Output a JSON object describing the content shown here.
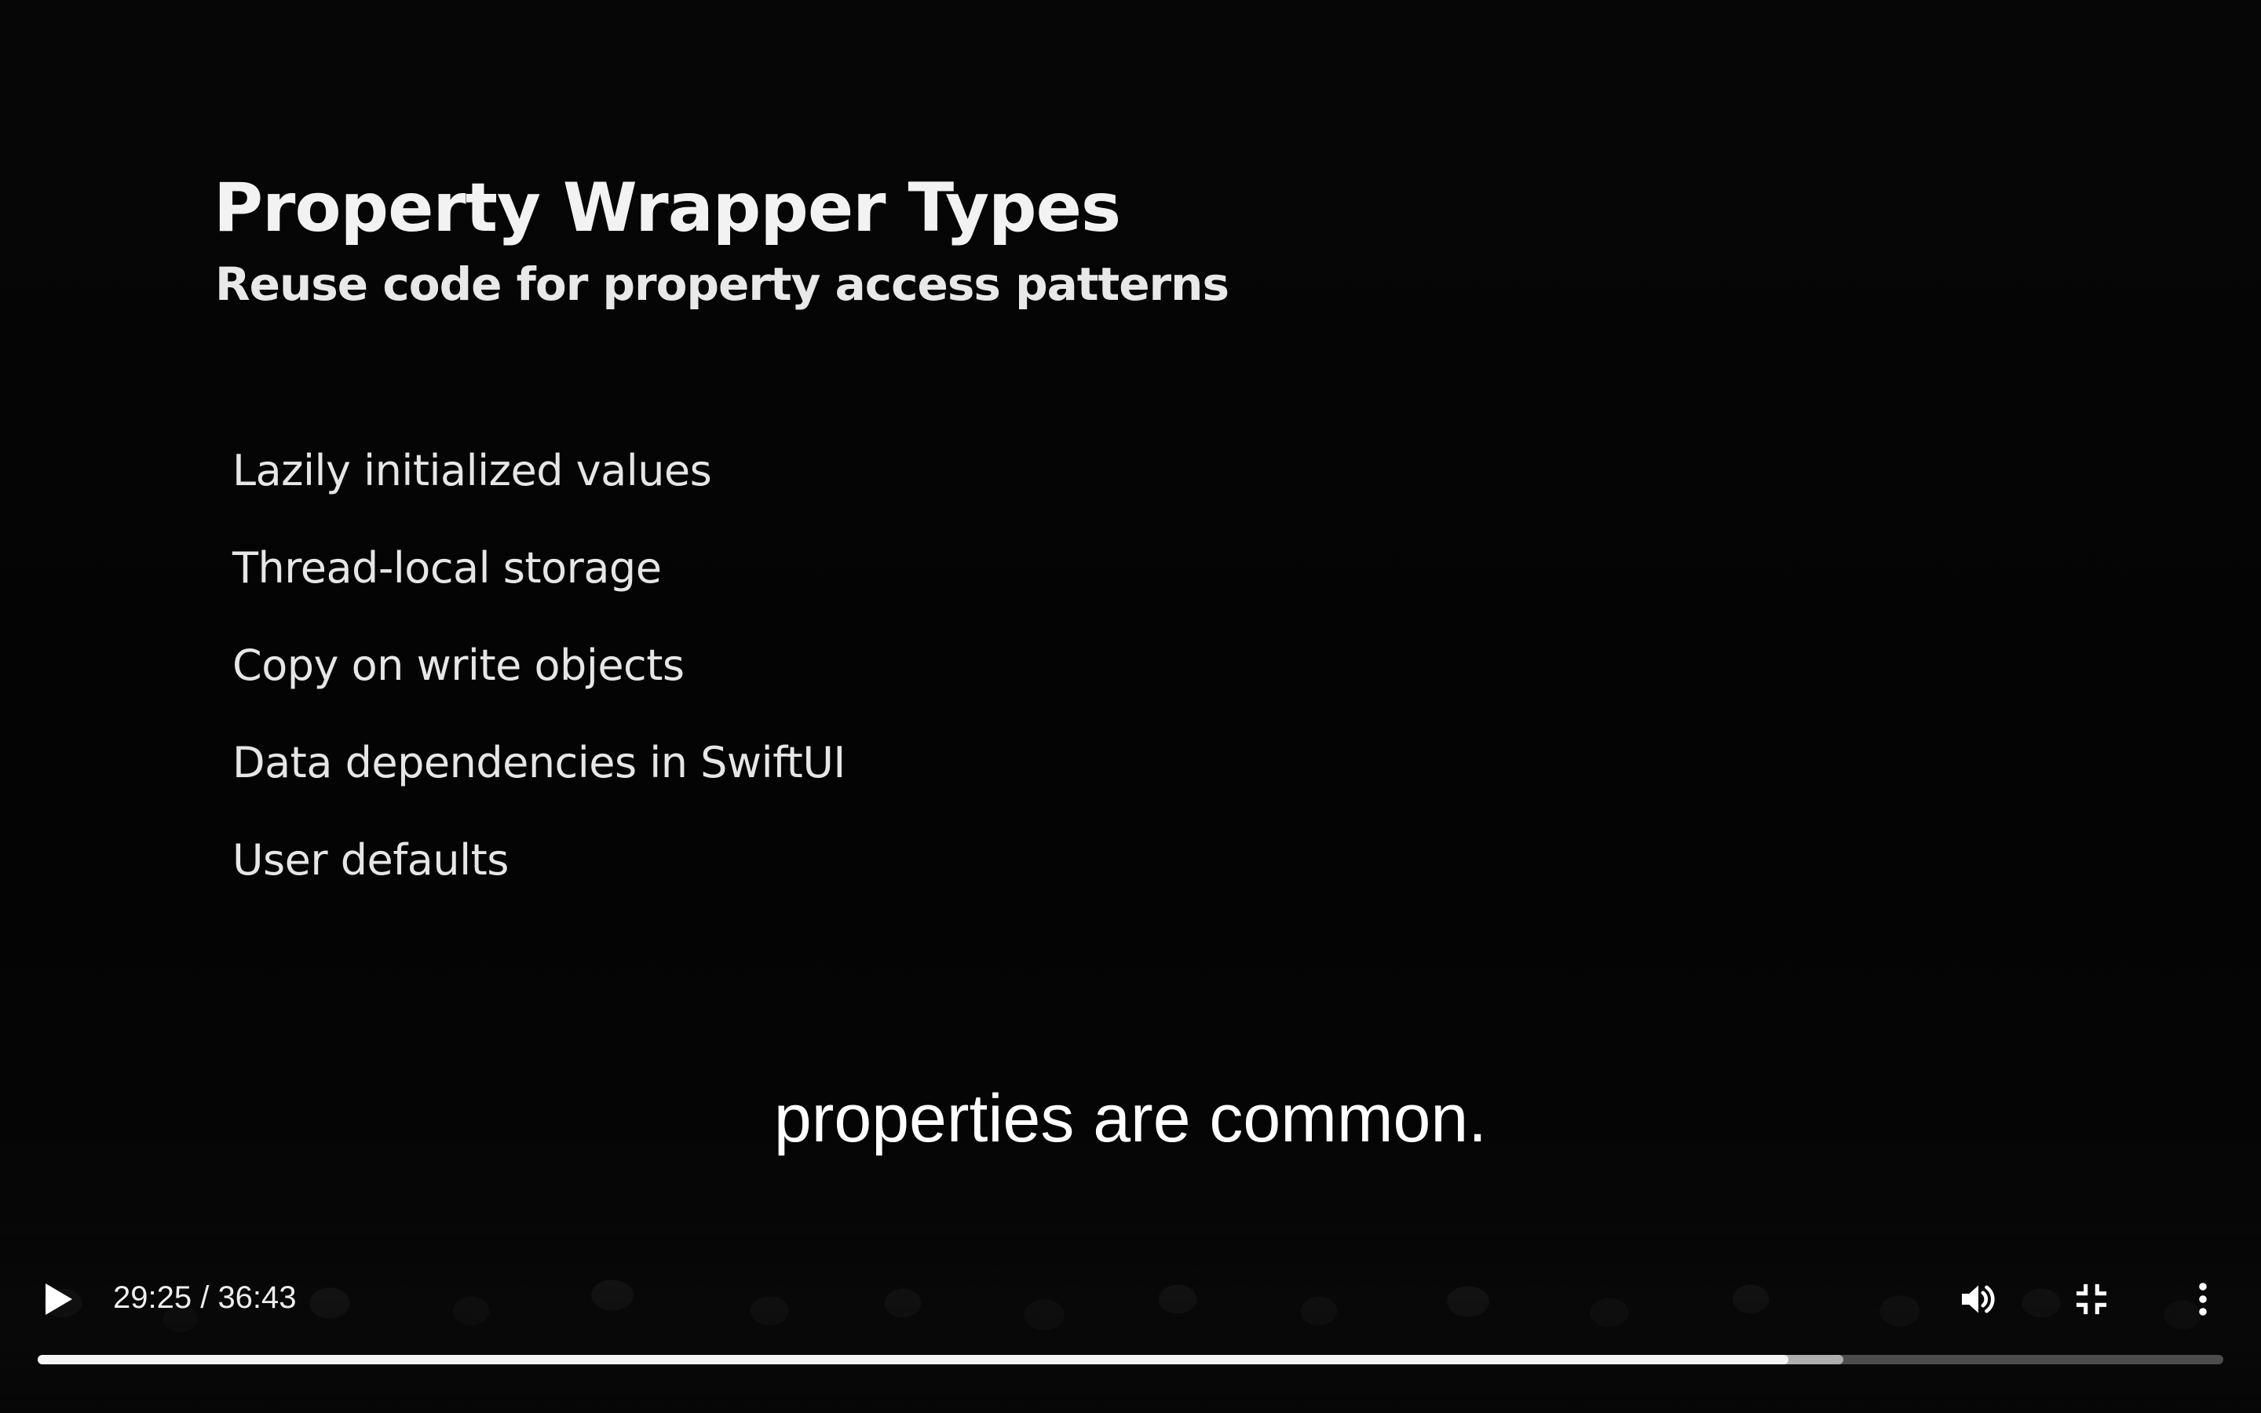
{
  "slide": {
    "title": "Property Wrapper Types",
    "subtitle": "Reuse code for property access patterns",
    "bullets": [
      "Lazily initialized values",
      "Thread-local storage",
      "Copy on write objects",
      "Data dependencies in SwiftUI",
      "User defaults"
    ]
  },
  "caption": {
    "text": "properties are common."
  },
  "player": {
    "time": "29:25 / 36:43",
    "current_time": "29:25",
    "duration": "36:43",
    "progress": {
      "played_fraction": 0.801,
      "buffered_fraction": 0.826
    },
    "icons": {
      "play": "play-icon",
      "volume": "volume-icon",
      "exit_fullscreen": "exit-fullscreen-icon",
      "more": "more-vert-icon"
    },
    "colors": {
      "progress_played": "#f5f5f5",
      "progress_track": "#5c5c5c"
    }
  }
}
